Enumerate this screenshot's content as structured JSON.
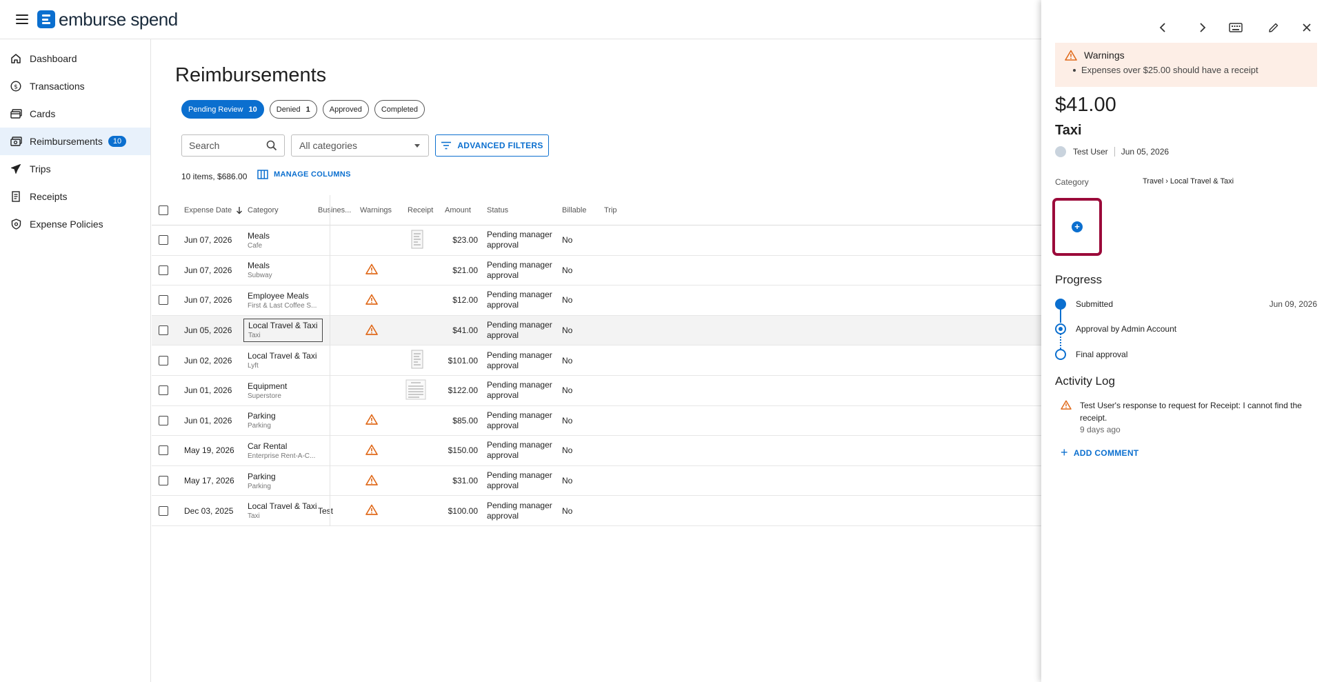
{
  "brand": {
    "name": "emburse spend",
    "accent": "#0b6fcf"
  },
  "sidebar": {
    "items": [
      {
        "label": "Dashboard",
        "icon": "home-icon"
      },
      {
        "label": "Transactions",
        "icon": "dollar-circle-icon"
      },
      {
        "label": "Cards",
        "icon": "cards-icon"
      },
      {
        "label": "Reimbursements",
        "icon": "reimbursement-icon",
        "badge": "10",
        "active": true
      },
      {
        "label": "Trips",
        "icon": "plane-icon"
      },
      {
        "label": "Receipts",
        "icon": "receipt-icon"
      },
      {
        "label": "Expense Policies",
        "icon": "shield-icon"
      }
    ]
  },
  "main": {
    "title": "Reimbursements",
    "tabs": [
      {
        "label": "Pending Review",
        "count": "10",
        "active": true
      },
      {
        "label": "Denied",
        "count": "1"
      },
      {
        "label": "Approved",
        "count": ""
      },
      {
        "label": "Completed",
        "count": ""
      }
    ],
    "search_placeholder": "Search",
    "category_select": "All categories",
    "advanced_filters": "ADVANCED FILTERS",
    "summary": "10 items, $686.00",
    "manage_columns": "MANAGE COLUMNS",
    "columns": [
      "Expense Date",
      "Category",
      "Busines...",
      "Warnings",
      "Receipt",
      "Amount",
      "Status",
      "Billable",
      "Trip"
    ],
    "rows": [
      {
        "date": "Jun 07, 2026",
        "cat": "Meals",
        "sub": "Cafe",
        "business": "",
        "warn": false,
        "receipt": "thumb",
        "amount": "$23.00",
        "status1": "Pending manager",
        "status2": "approval",
        "billable": "No"
      },
      {
        "date": "Jun 07, 2026",
        "cat": "Meals",
        "sub": "Subway",
        "business": "",
        "warn": true,
        "receipt": "",
        "amount": "$21.00",
        "status1": "Pending manager",
        "status2": "approval",
        "billable": "No"
      },
      {
        "date": "Jun 07, 2026",
        "cat": "Employee Meals",
        "sub": "First & Last Coffee S...",
        "business": "",
        "warn": true,
        "receipt": "",
        "amount": "$12.00",
        "status1": "Pending manager",
        "status2": "approval",
        "billable": "No"
      },
      {
        "date": "Jun 05, 2026",
        "cat": "Local Travel & Taxi",
        "sub": "Taxi",
        "business": "",
        "warn": true,
        "receipt": "",
        "amount": "$41.00",
        "status1": "Pending manager",
        "status2": "approval",
        "billable": "No",
        "selected": true
      },
      {
        "date": "Jun 02, 2026",
        "cat": "Local Travel & Taxi",
        "sub": "Lyft",
        "business": "",
        "warn": false,
        "receipt": "thumb",
        "amount": "$101.00",
        "status1": "Pending manager",
        "status2": "approval",
        "billable": "No"
      },
      {
        "date": "Jun 01, 2026",
        "cat": "Equipment",
        "sub": "Superstore",
        "business": "",
        "warn": false,
        "receipt": "wide",
        "amount": "$122.00",
        "status1": "Pending manager",
        "status2": "approval",
        "billable": "No"
      },
      {
        "date": "Jun 01, 2026",
        "cat": "Parking",
        "sub": "Parking",
        "business": "",
        "warn": true,
        "receipt": "",
        "amount": "$85.00",
        "status1": "Pending manager",
        "status2": "approval",
        "billable": "No"
      },
      {
        "date": "May 19, 2026",
        "cat": "Car Rental",
        "sub": "Enterprise Rent-A-C...",
        "business": "",
        "warn": true,
        "receipt": "",
        "amount": "$150.00",
        "status1": "Pending manager",
        "status2": "approval",
        "billable": "No"
      },
      {
        "date": "May 17, 2026",
        "cat": "Parking",
        "sub": "Parking",
        "business": "",
        "warn": true,
        "receipt": "",
        "amount": "$31.00",
        "status1": "Pending manager",
        "status2": "approval",
        "billable": "No"
      },
      {
        "date": "Dec 03, 2025",
        "cat": "Local Travel & Taxi",
        "sub": "Taxi",
        "business": "Test",
        "warn": true,
        "receipt": "",
        "amount": "$100.00",
        "status1": "Pending manager",
        "status2": "approval",
        "billable": "No"
      }
    ]
  },
  "panel": {
    "warnings_title": "Warnings",
    "warning_item": "Expenses over $25.00 should have a receipt",
    "amount": "$41.00",
    "title": "Taxi",
    "user": "Test User",
    "date": "Jun 05, 2026",
    "category_label": "Category",
    "category_value": "Travel › Local Travel & Taxi",
    "progress_title": "Progress",
    "steps": [
      {
        "label": "Submitted",
        "date": "Jun 09, 2026"
      },
      {
        "label": "Approval by Admin Account",
        "date": ""
      },
      {
        "label": "Final approval",
        "date": ""
      }
    ],
    "activity_title": "Activity Log",
    "activity_text": "Test User's response to request for Receipt: I cannot find the receipt.",
    "activity_ago": "9 days ago",
    "add_comment": "ADD COMMENT"
  }
}
